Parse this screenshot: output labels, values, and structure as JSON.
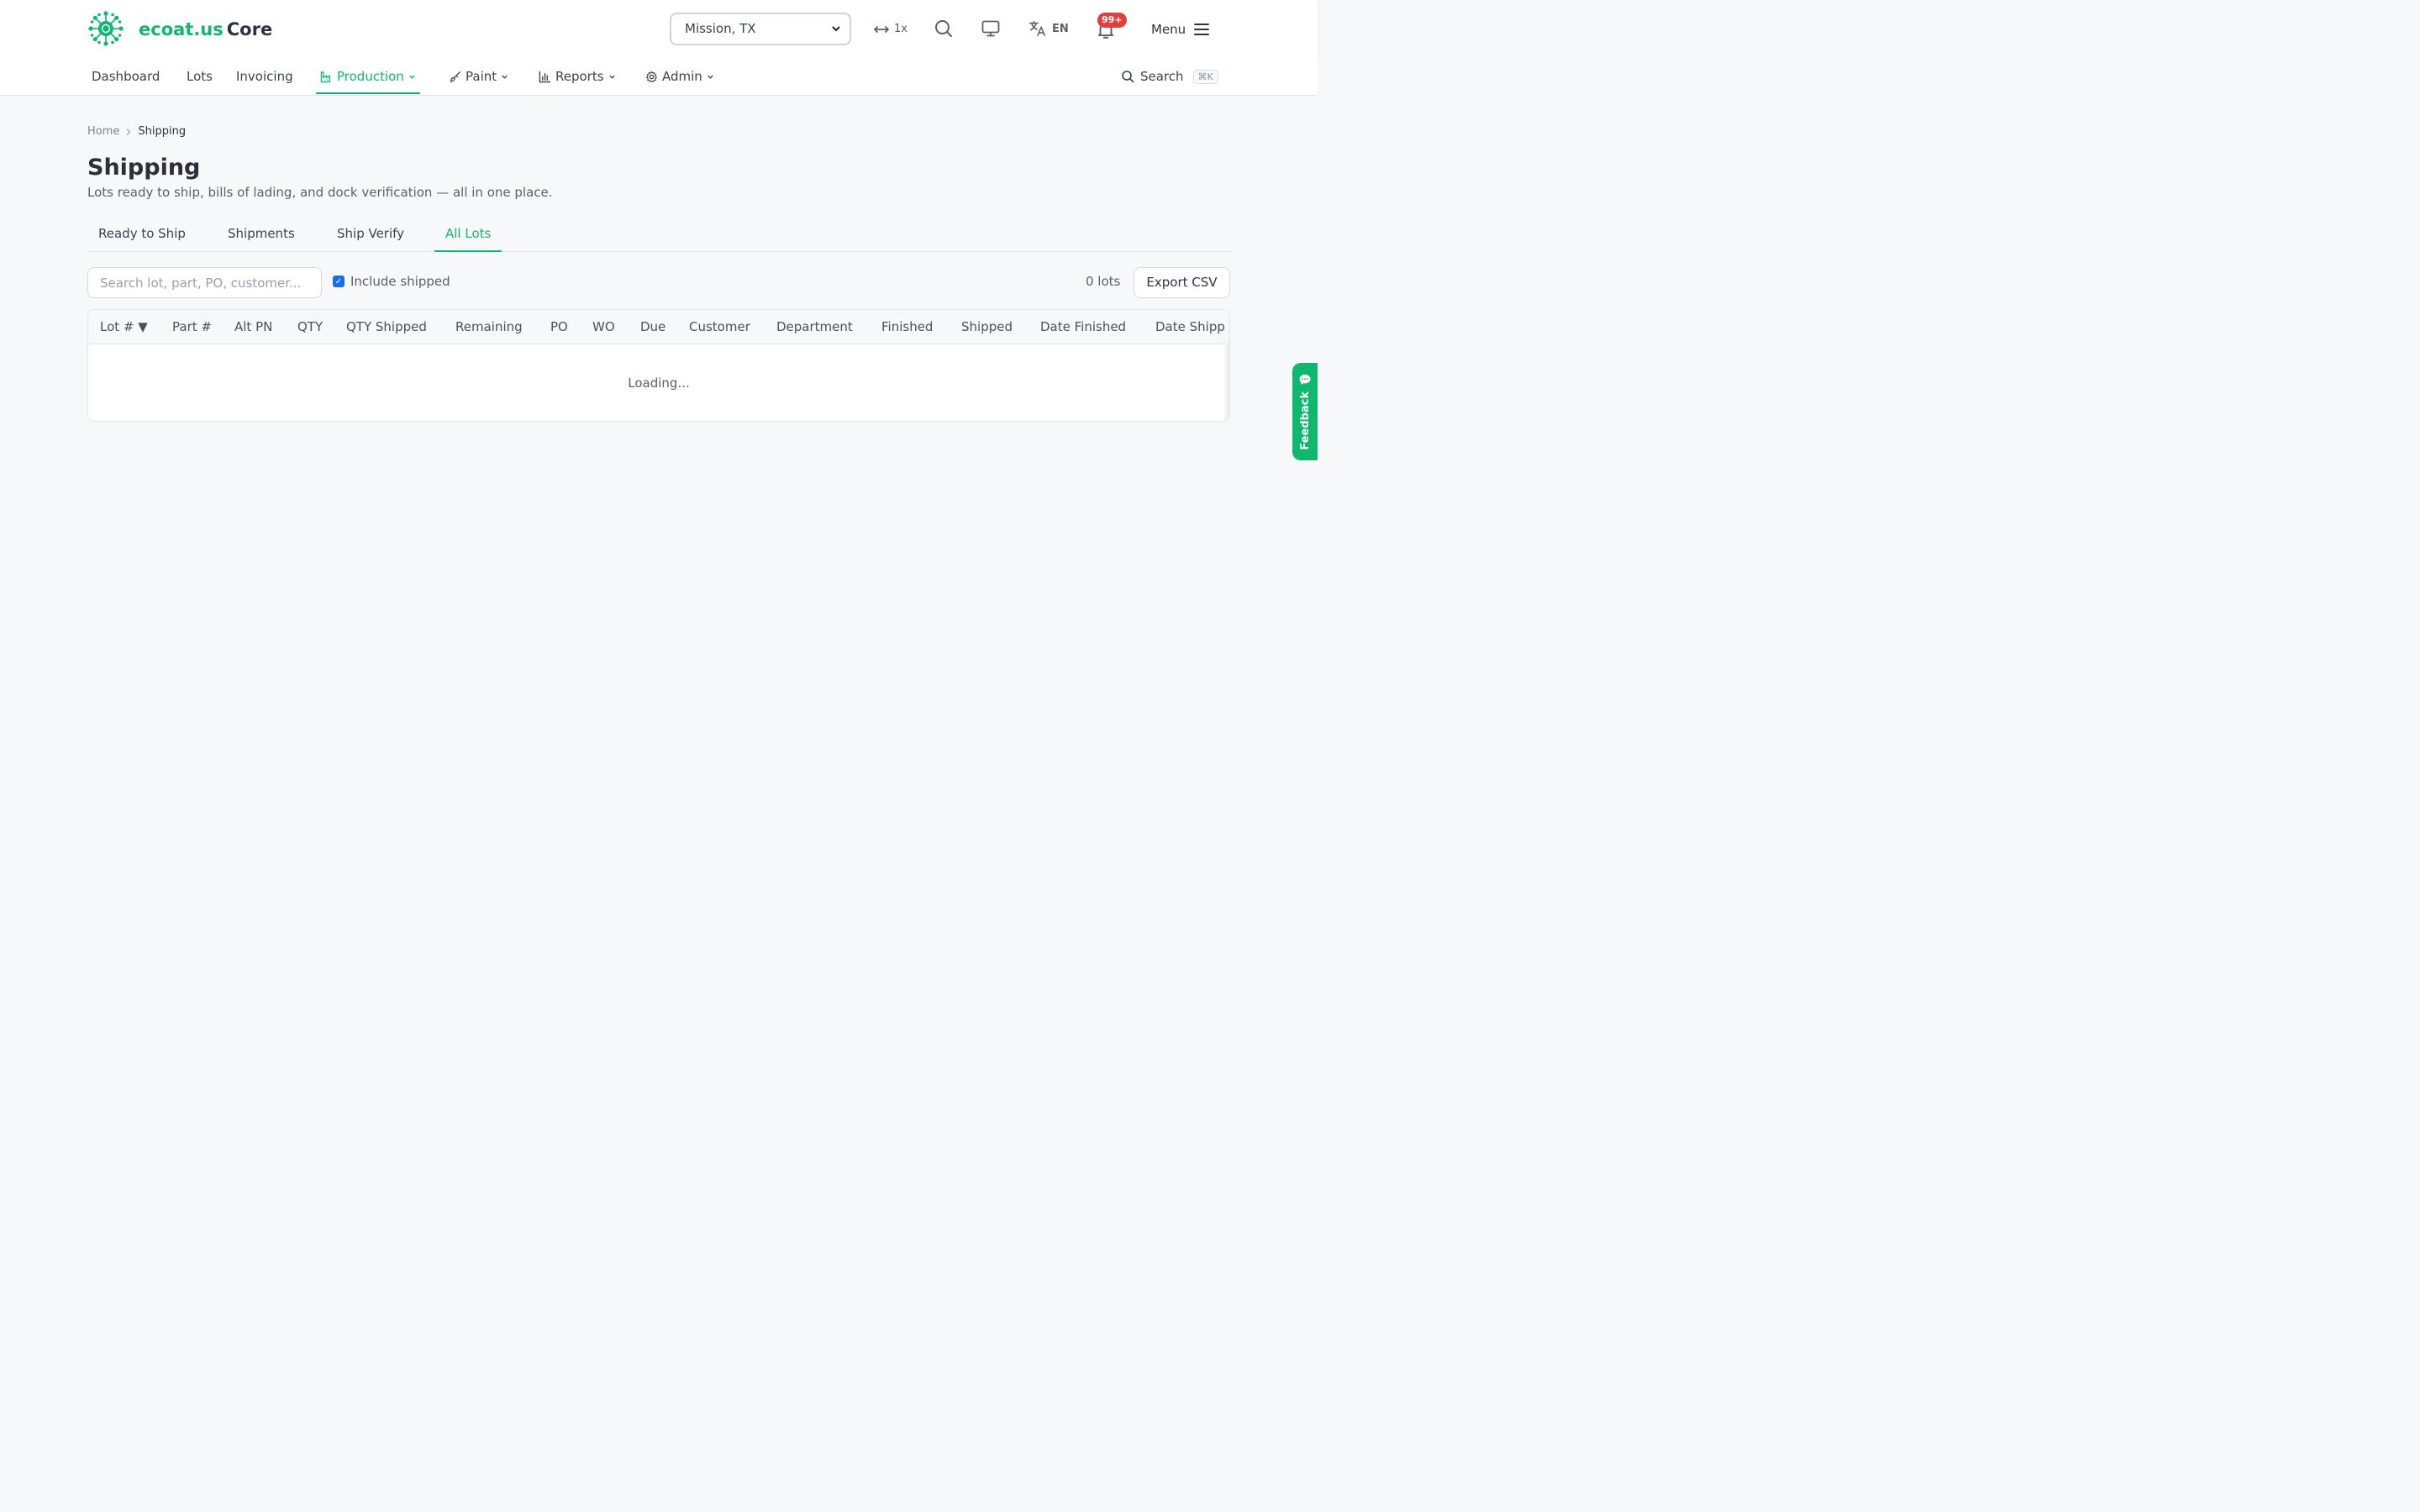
{
  "header": {
    "brand_primary": "ecoat.us",
    "brand_secondary": "Core",
    "location_select": "Mission, TX",
    "width_label": "1x",
    "language": "EN",
    "notification_badge": "99+",
    "menu_label": "Menu"
  },
  "nav": {
    "items": [
      {
        "label": "Dashboard"
      },
      {
        "label": "Lots"
      },
      {
        "label": "Invoicing"
      },
      {
        "label": "Production"
      },
      {
        "label": "Paint"
      },
      {
        "label": "Reports"
      },
      {
        "label": "Admin"
      }
    ],
    "active": "Production",
    "search_label": "Search",
    "search_shortcut": "⌘K"
  },
  "breadcrumb": {
    "home": "Home",
    "current": "Shipping"
  },
  "page": {
    "title": "Shipping",
    "subtitle": "Lots ready to ship, bills of lading, and dock verification — all in one place."
  },
  "tabs": [
    {
      "label": "Ready to Ship"
    },
    {
      "label": "Shipments"
    },
    {
      "label": "Ship Verify"
    },
    {
      "label": "All Lots"
    }
  ],
  "active_tab": "All Lots",
  "filters": {
    "search_placeholder": "Search lot, part, PO, customer...",
    "include_shipped_label": "Include shipped",
    "include_shipped_checked": true,
    "lot_count": "0 lots",
    "export_label": "Export CSV"
  },
  "table": {
    "columns": [
      "Lot # ▼",
      "Part #",
      "Alt PN",
      "QTY",
      "QTY Shipped",
      "Remaining",
      "PO",
      "WO",
      "Due",
      "Customer",
      "Department",
      "Finished",
      "Shipped",
      "Date Finished",
      "Date Shipp"
    ],
    "loading_text": "Loading..."
  },
  "feedback_label": "Feedback",
  "colors": {
    "accent": "#10b76e",
    "badge": "#e43d3d",
    "checkbox": "#1a6fe8"
  }
}
